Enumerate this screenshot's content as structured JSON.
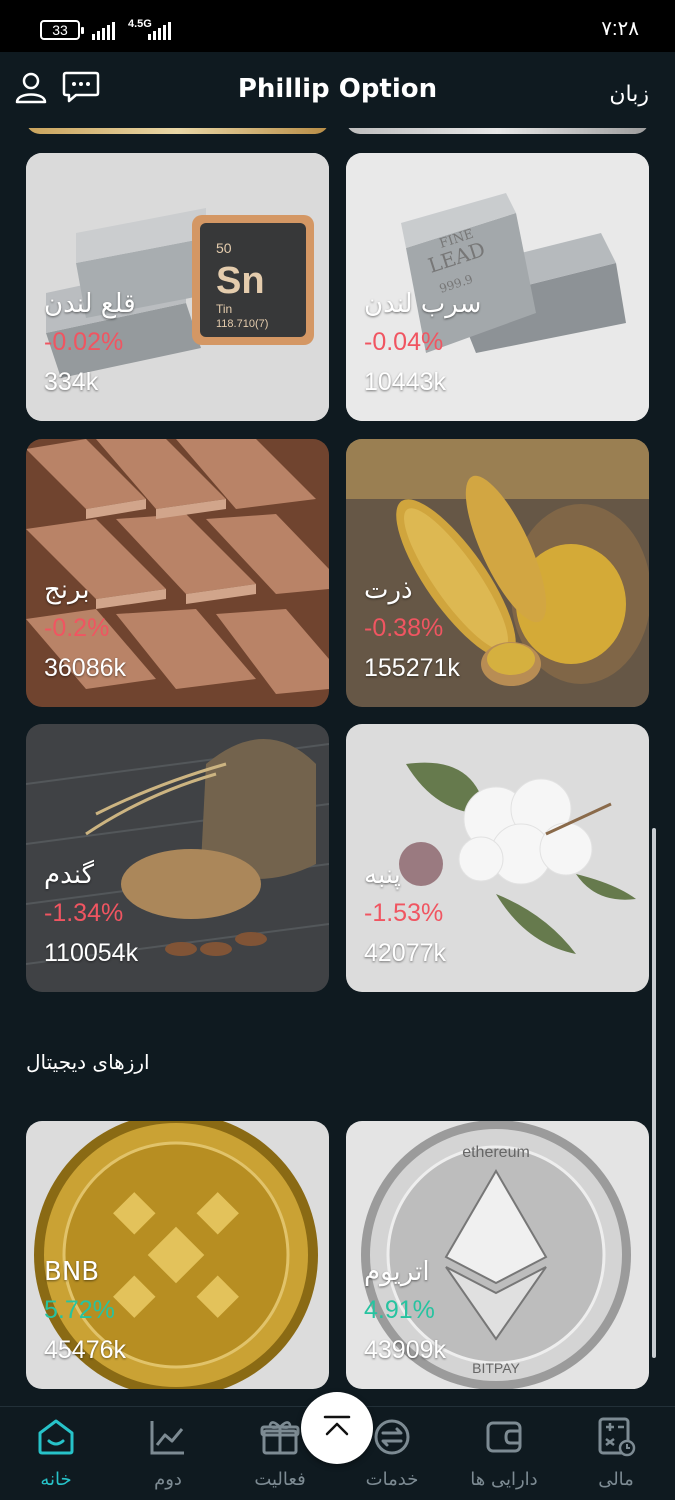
{
  "status_bar": {
    "battery": "33",
    "network": "4.5G",
    "time": "۷:۲۸"
  },
  "header": {
    "title": "Phillip Option",
    "language_label": "زبان"
  },
  "cards": [
    {
      "name": "قلع لندن",
      "change": "-0.02%",
      "volume": "334k",
      "trend": "negative"
    },
    {
      "name": "سرب لندن",
      "change": "-0.04%",
      "volume": "10443k",
      "trend": "negative"
    },
    {
      "name": "برنج",
      "change": "-0.2%",
      "volume": "36086k",
      "trend": "negative"
    },
    {
      "name": "ذرت",
      "change": "-0.38%",
      "volume": "155271k",
      "trend": "negative"
    },
    {
      "name": "گندم",
      "change": "-1.34%",
      "volume": "110054k",
      "trend": "negative"
    },
    {
      "name": "پنبه",
      "change": "-1.53%",
      "volume": "42077k",
      "trend": "negative"
    }
  ],
  "section": {
    "title": "ارزهای دیجیتال"
  },
  "crypto_cards": [
    {
      "name": "BNB",
      "change": "5.72%",
      "volume": "45476k",
      "trend": "positive"
    },
    {
      "name": "اتریوم",
      "change": "4.91%",
      "volume": "43909k",
      "trend": "positive"
    }
  ],
  "tin_tile": {
    "number": "50",
    "symbol": "Sn",
    "name": "Tin",
    "mass": "118.710(7)"
  },
  "lead_bar": {
    "line1": "FINE",
    "line2": "LEAD",
    "line3": "999.9"
  },
  "eth_coin": {
    "text_top": "ethereum",
    "text_bottom": "BITPAY"
  },
  "bottom_nav": [
    {
      "label": "خانه",
      "icon": "home-icon",
      "active": true
    },
    {
      "label": "دوم",
      "icon": "chart-icon",
      "active": false
    },
    {
      "label": "فعالیت",
      "icon": "gift-icon",
      "active": false
    },
    {
      "label": "خدمات",
      "icon": "exchange-icon",
      "active": false
    },
    {
      "label": "دارایی ها",
      "icon": "wallet-icon",
      "active": false
    },
    {
      "label": "مالی",
      "icon": "calculator-icon",
      "active": false
    }
  ],
  "colors": {
    "background": "#0f1a20",
    "negative": "#f05561",
    "positive": "#27c3a0",
    "accent": "#27c3c9"
  }
}
